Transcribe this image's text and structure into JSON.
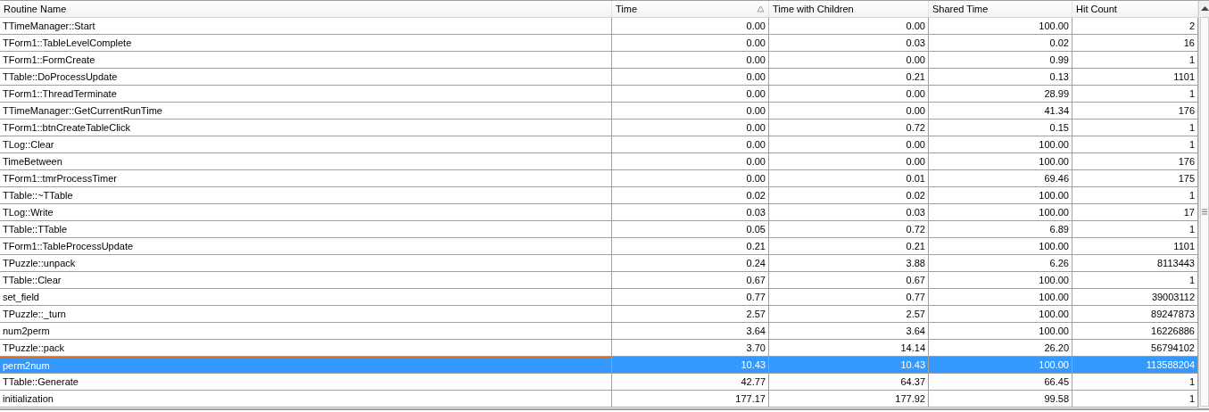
{
  "table": {
    "columns": [
      {
        "label": "Routine Name",
        "sorted": false
      },
      {
        "label": "Time",
        "sorted": true
      },
      {
        "label": "Time with Children",
        "sorted": false
      },
      {
        "label": "Shared Time",
        "sorted": false
      },
      {
        "label": "Hit Count",
        "sorted": false
      }
    ],
    "rows": [
      {
        "cells": [
          "TTimeManager::Start",
          "0.00",
          "0.00",
          "100.00",
          "2"
        ],
        "selected": false
      },
      {
        "cells": [
          "TForm1::TableLevelComplete",
          "0.00",
          "0.03",
          "0.02",
          "16"
        ],
        "selected": false
      },
      {
        "cells": [
          "TForm1::FormCreate",
          "0.00",
          "0.00",
          "0.99",
          "1"
        ],
        "selected": false
      },
      {
        "cells": [
          "TTable::DoProcessUpdate",
          "0.00",
          "0.21",
          "0.13",
          "1101"
        ],
        "selected": false
      },
      {
        "cells": [
          "TForm1::ThreadTerminate",
          "0.00",
          "0.00",
          "28.99",
          "1"
        ],
        "selected": false
      },
      {
        "cells": [
          "TTimeManager::GetCurrentRunTime",
          "0.00",
          "0.00",
          "41.34",
          "176"
        ],
        "selected": false
      },
      {
        "cells": [
          "TForm1::btnCreateTableClick",
          "0.00",
          "0.72",
          "0.15",
          "1"
        ],
        "selected": false
      },
      {
        "cells": [
          "TLog::Clear",
          "0.00",
          "0.00",
          "100.00",
          "1"
        ],
        "selected": false
      },
      {
        "cells": [
          "TimeBetween",
          "0.00",
          "0.00",
          "100.00",
          "176"
        ],
        "selected": false
      },
      {
        "cells": [
          "TForm1::tmrProcessTimer",
          "0.00",
          "0.01",
          "69.46",
          "175"
        ],
        "selected": false
      },
      {
        "cells": [
          "TTable::~TTable",
          "0.02",
          "0.02",
          "100.00",
          "1"
        ],
        "selected": false
      },
      {
        "cells": [
          "TLog::Write",
          "0.03",
          "0.03",
          "100.00",
          "17"
        ],
        "selected": false
      },
      {
        "cells": [
          "TTable::TTable",
          "0.05",
          "0.72",
          "6.89",
          "1"
        ],
        "selected": false
      },
      {
        "cells": [
          "TForm1::TableProcessUpdate",
          "0.21",
          "0.21",
          "100.00",
          "1101"
        ],
        "selected": false
      },
      {
        "cells": [
          "TPuzzle::unpack",
          "0.24",
          "3.88",
          "6.26",
          "8113443"
        ],
        "selected": false
      },
      {
        "cells": [
          "TTable::Clear",
          "0.67",
          "0.67",
          "100.00",
          "1"
        ],
        "selected": false
      },
      {
        "cells": [
          "set_field",
          "0.77",
          "0.77",
          "100.00",
          "39003112"
        ],
        "selected": false
      },
      {
        "cells": [
          "TPuzzle::_turn",
          "2.57",
          "2.57",
          "100.00",
          "89247873"
        ],
        "selected": false
      },
      {
        "cells": [
          "num2perm",
          "3.64",
          "3.64",
          "100.00",
          "16226886"
        ],
        "selected": false
      },
      {
        "cells": [
          "TPuzzle::pack",
          "3.70",
          "14.14",
          "26.20",
          "56794102"
        ],
        "selected": false
      },
      {
        "cells": [
          "perm2num",
          "10.43",
          "10.43",
          "100.00",
          "113588204"
        ],
        "selected": true
      },
      {
        "cells": [
          "TTable::Generate",
          "42.77",
          "64.37",
          "66.45",
          "1"
        ],
        "selected": false
      },
      {
        "cells": [
          "initialization",
          "177.17",
          "177.92",
          "99.58",
          "1"
        ],
        "selected": false
      }
    ]
  }
}
